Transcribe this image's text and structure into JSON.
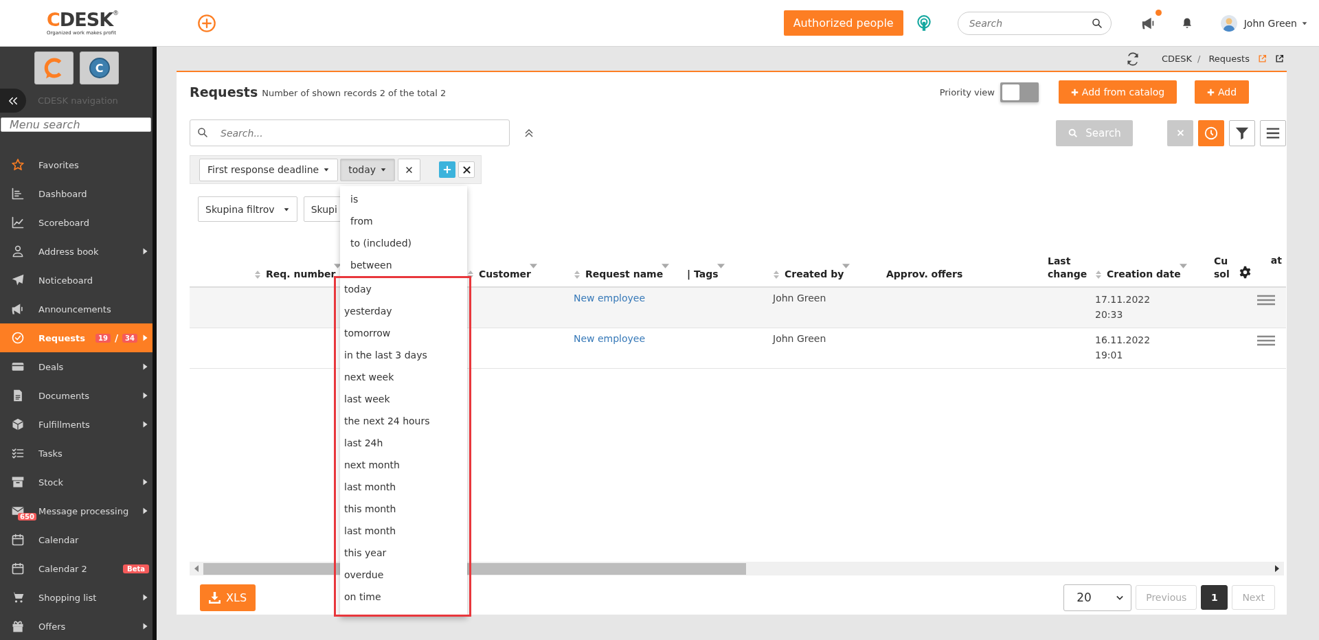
{
  "header": {
    "logo": {
      "mark": "C",
      "text": "DESK",
      "registered": "®",
      "tagline": "Organized work makes profit"
    },
    "authorized_button": "Authorized people",
    "search": {
      "placeholder": "Search"
    },
    "notification_dot": true,
    "user": "John Green"
  },
  "sidebar": {
    "app_tiles": [
      {
        "letter": "C"
      }
    ],
    "nav_label": "CDESK navigation",
    "menu_search": {
      "placeholder": "Menu search"
    },
    "items": [
      {
        "label": "Favorites",
        "selected": false,
        "expandable": false
      },
      {
        "label": "Dashboard",
        "selected": false,
        "expandable": false
      },
      {
        "label": "Scoreboard",
        "selected": false,
        "expandable": false
      },
      {
        "label": "Address book",
        "selected": false,
        "expandable": true
      },
      {
        "label": "Noticeboard",
        "selected": false,
        "expandable": false
      },
      {
        "label": "Announcements",
        "selected": false,
        "expandable": false
      },
      {
        "label": "Requests",
        "selected": true,
        "expandable": true,
        "counts": [
          "19",
          "34"
        ],
        "separator": "/"
      },
      {
        "label": "Deals",
        "selected": false,
        "expandable": true
      },
      {
        "label": "Documents",
        "selected": false,
        "expandable": true
      },
      {
        "label": "Fulfillments",
        "selected": false,
        "expandable": true
      },
      {
        "label": "Tasks",
        "selected": false,
        "expandable": false
      },
      {
        "label": "Stock",
        "selected": false,
        "expandable": true
      },
      {
        "label": "Message processing",
        "selected": false,
        "expandable": true,
        "icon_badge": "650"
      },
      {
        "label": "Calendar",
        "selected": false,
        "expandable": false
      },
      {
        "label": "Calendar 2",
        "selected": false,
        "expandable": false,
        "tag": "Beta"
      },
      {
        "label": "Shopping list",
        "selected": false,
        "expandable": true
      },
      {
        "label": "Offers",
        "selected": false,
        "expandable": true
      }
    ]
  },
  "breadcrumb": {
    "items": [
      "CDESK",
      "Requests"
    ],
    "separator": "/"
  },
  "page": {
    "title": "Requests",
    "subtitle": "Number of shown records 2 of the total 2",
    "priority_view": {
      "label": "Priority view",
      "on": false
    },
    "add_from_catalog": "Add from catalog",
    "add": "Add",
    "search": {
      "placeholder": "Search..."
    },
    "search_button": "Search"
  },
  "filter": {
    "field": "First response deadline",
    "operator": "today",
    "open": true,
    "options": [
      "is",
      "from",
      "to (included)",
      "between"
    ],
    "highlighted_options": [
      "today",
      "yesterday",
      "tomorrow",
      "in the last 3 days",
      "next week",
      "last week",
      "the next 24 hours",
      "last 24h",
      "next month",
      "last month",
      "this month",
      "last month",
      "this year",
      "overdue",
      "on time"
    ]
  },
  "filter_groups": [
    "Skupina filtrov",
    "Skupi"
  ],
  "table": {
    "columns": [
      {
        "label": "Req. number",
        "sortable": true,
        "filterable": true
      },
      {
        "label": "Customer",
        "sortable": true,
        "filterable": true
      },
      {
        "label": "Request name",
        "sortable": true,
        "filterable": true
      },
      {
        "label": "| Tags",
        "sortable": false,
        "filterable": true
      },
      {
        "label": "Created by",
        "sortable": true,
        "filterable": true
      },
      {
        "label": "Approv. offers",
        "sortable": false,
        "filterable": false
      },
      {
        "label": "Last change",
        "sortable": false,
        "filterable": false
      },
      {
        "label": "Creation date",
        "sortable": true,
        "filterable": true
      },
      {
        "label": "Cu sol",
        "sortable": false,
        "filterable": false
      },
      {
        "label": "at",
        "sortable": false,
        "filterable": false
      }
    ],
    "rows": [
      {
        "request_name": "New employee",
        "created_by": "John Green",
        "creation_date": "17.11.2022 20:33"
      },
      {
        "request_name": "New employee",
        "created_by": "John Green",
        "creation_date": "16.11.2022 19:01"
      }
    ]
  },
  "footer": {
    "export_button": "XLS",
    "per_page": "20",
    "previous": {
      "label": "Previous",
      "disabled": true
    },
    "pages": [
      {
        "label": "1",
        "selected": true
      }
    ],
    "next": {
      "label": "Next",
      "disabled": true
    }
  }
}
